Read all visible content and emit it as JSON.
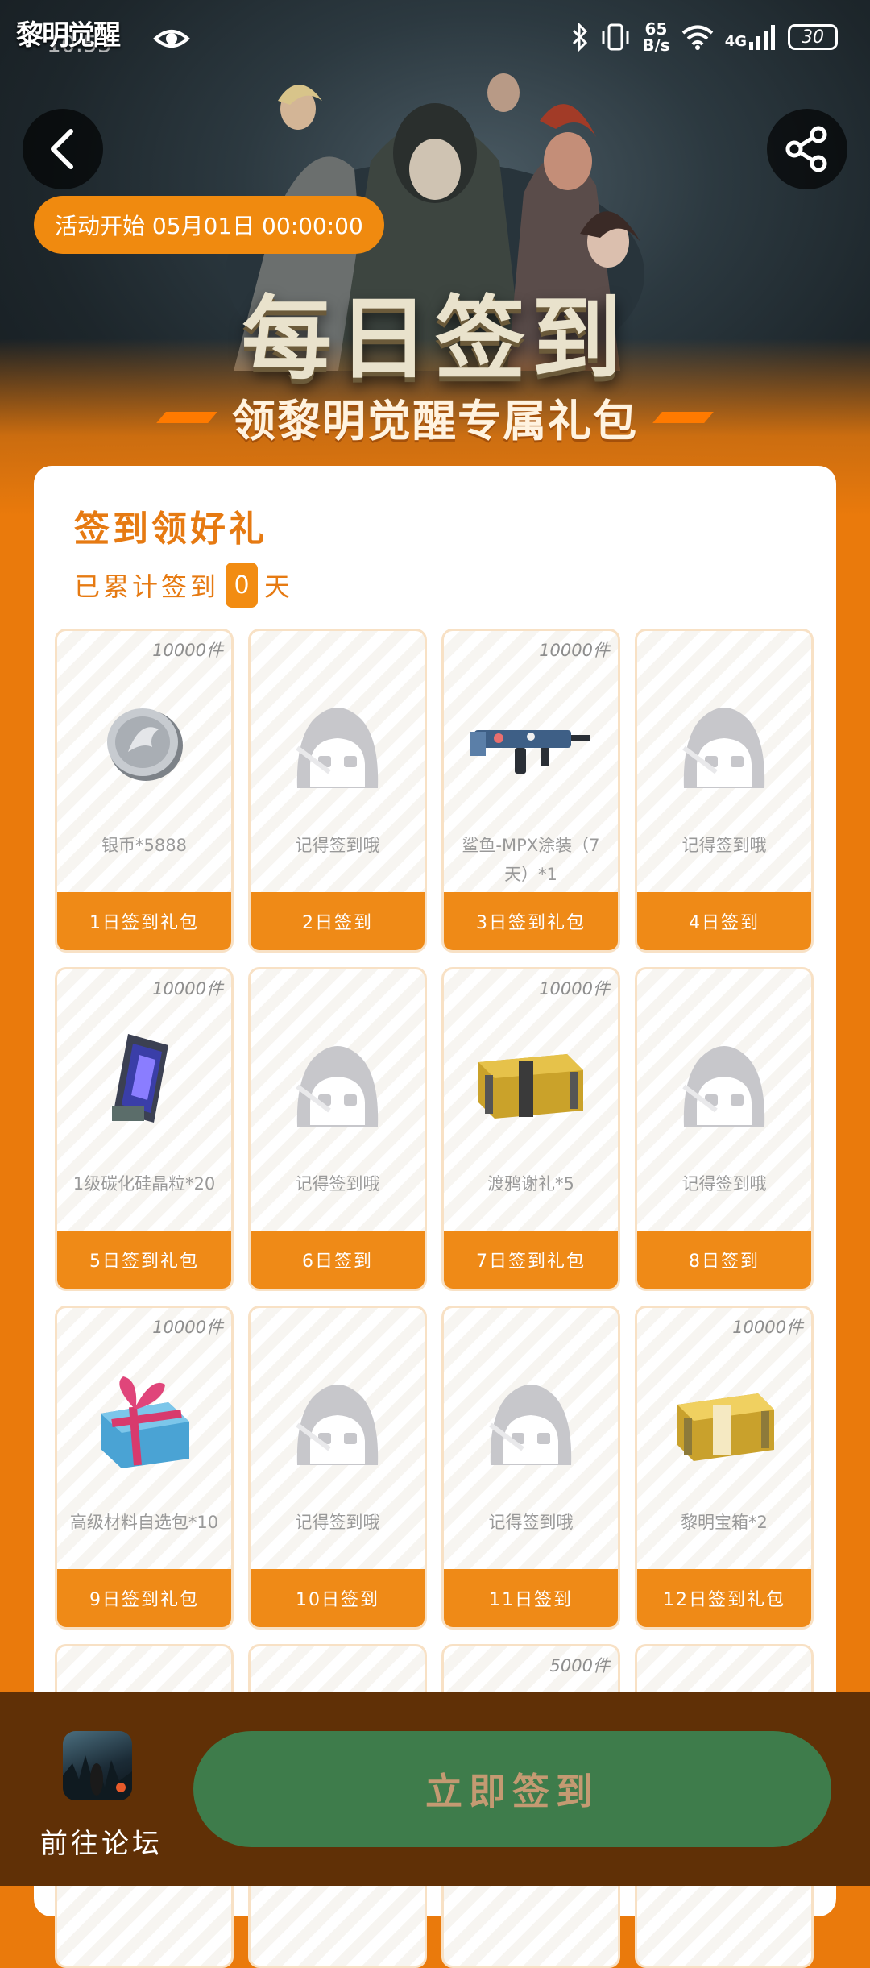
{
  "status_bar": {
    "app_logo": "黎明觉醒",
    "time": "10:53",
    "net_speed_value": "65",
    "net_speed_unit": "B/s",
    "network_type": "4G",
    "battery": "30",
    "icons": [
      "eye-icon",
      "bluetooth-icon",
      "vibrate-icon",
      "wifi-icon",
      "signal-icon",
      "battery-icon"
    ]
  },
  "header": {
    "back_icon": "chevron-left-icon",
    "share_icon": "share-icon",
    "start_time": "活动开始 05月01日 00:00:00",
    "title": "每日签到",
    "subtitle": "领黎明觉醒专属礼包"
  },
  "card": {
    "title": "签到领好礼",
    "count_prefix": "已累计签到",
    "count_value": "0",
    "count_suffix": "天"
  },
  "rewards": [
    {
      "qty": "10000件",
      "icon": "silver-coin-icon",
      "name": "银币*5888",
      "footer": "1日签到礼包"
    },
    {
      "qty": "",
      "icon": "placeholder-hood-icon",
      "name": "记得签到哦",
      "footer": "2日签到"
    },
    {
      "qty": "10000件",
      "icon": "smg-icon",
      "name": "鲨鱼-MPX涂装（7天）*1",
      "footer": "3日签到礼包"
    },
    {
      "qty": "",
      "icon": "placeholder-hood-icon",
      "name": "记得签到哦",
      "footer": "4日签到"
    },
    {
      "qty": "10000件",
      "icon": "crystal-icon",
      "name": "1级碳化硅晶粒*20",
      "footer": "5日签到礼包"
    },
    {
      "qty": "",
      "icon": "placeholder-hood-icon",
      "name": "记得签到哦",
      "footer": "6日签到"
    },
    {
      "qty": "10000件",
      "icon": "supply-crate-icon",
      "name": "渡鸦谢礼*5",
      "footer": "7日签到礼包"
    },
    {
      "qty": "",
      "icon": "placeholder-hood-icon",
      "name": "记得签到哦",
      "footer": "8日签到"
    },
    {
      "qty": "10000件",
      "icon": "gift-box-icon",
      "name": "高级材料自选包*10",
      "footer": "9日签到礼包"
    },
    {
      "qty": "",
      "icon": "placeholder-hood-icon",
      "name": "记得签到哦",
      "footer": "10日签到"
    },
    {
      "qty": "",
      "icon": "placeholder-hood-icon",
      "name": "记得签到哦",
      "footer": "11日签到"
    },
    {
      "qty": "10000件",
      "icon": "gold-chest-icon",
      "name": "黎明宝箱*2",
      "footer": "12日签到礼包"
    },
    {
      "qty": "",
      "icon": "",
      "name": "",
      "footer": ""
    },
    {
      "qty": "",
      "icon": "",
      "name": "",
      "footer": ""
    },
    {
      "qty": "5000件",
      "icon": "",
      "name": "",
      "footer": ""
    },
    {
      "qty": "",
      "icon": "",
      "name": "",
      "footer": ""
    }
  ],
  "bottom_bar": {
    "forum_icon": "game-app-icon",
    "forum_label": "前往论坛",
    "signin_label": "立即签到"
  },
  "colors": {
    "accent": "#ea7a0c",
    "tile_footer": "#ef8a17",
    "signin_button": "#3e7c4b",
    "bottom_bar": "#603006"
  }
}
